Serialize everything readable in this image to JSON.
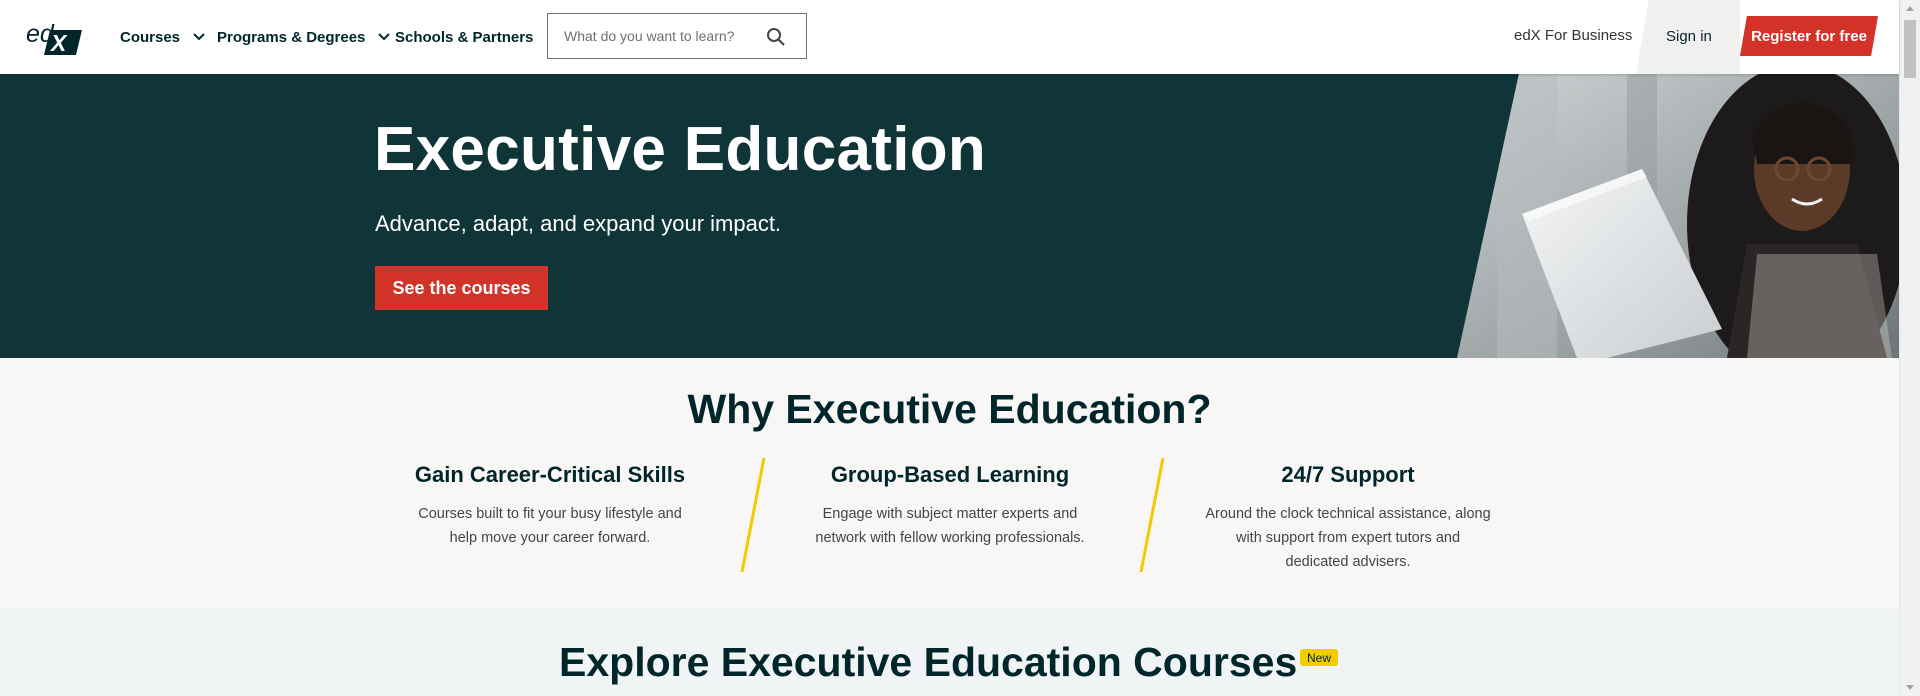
{
  "header": {
    "logo_text": "edX",
    "nav": [
      {
        "label": "Courses",
        "has_dropdown": true,
        "icon": "chevron-down-icon"
      },
      {
        "label": "Programs & Degrees",
        "has_dropdown": true,
        "icon": "chevron-down-icon"
      },
      {
        "label": "Schools & Partners",
        "has_dropdown": false
      }
    ],
    "search": {
      "placeholder": "What do you want to learn?",
      "value": "",
      "icon": "search-icon"
    },
    "business_link": "edX For Business",
    "sign_in": "Sign in",
    "register": "Register for free"
  },
  "hero": {
    "title": "Executive Education",
    "subtitle": "Advance, adapt, and expand your impact.",
    "cta": "See the courses"
  },
  "why": {
    "title": "Why Executive Education?",
    "features": [
      {
        "title": "Gain Career-Critical Skills",
        "lines": [
          "Courses built to fit your busy lifestyle and",
          "help move your career forward."
        ]
      },
      {
        "title": "Group-Based Learning",
        "lines": [
          "Engage with subject matter experts and",
          "network with fellow working professionals."
        ]
      },
      {
        "title": "24/7 Support",
        "lines": [
          "Around the clock technical assistance, along",
          "with support from expert tutors and",
          "dedicated advisers."
        ]
      }
    ]
  },
  "explore": {
    "title": "Explore Executive Education Courses",
    "badge": "New"
  },
  "colors": {
    "brand_dark": "#0f3538",
    "accent_red": "#d23228",
    "accent_yellow": "#f0cc00",
    "text_dark": "#00262b"
  }
}
